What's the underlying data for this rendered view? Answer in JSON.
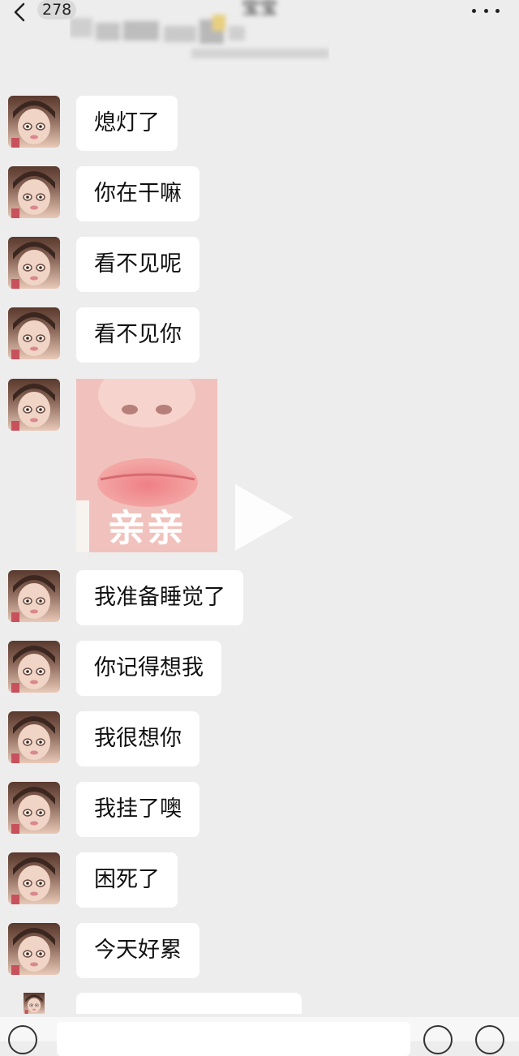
{
  "header": {
    "back_icon": "chevron-left-icon",
    "unread_count": "278",
    "title": "宝宝",
    "more_icon": "more-dots-icon"
  },
  "messages": [
    {
      "type": "text",
      "text": "熄灯了"
    },
    {
      "type": "text",
      "text": "你在干嘛"
    },
    {
      "type": "text",
      "text": "看不见呢"
    },
    {
      "type": "text",
      "text": "看不见你"
    },
    {
      "type": "sticker",
      "caption": "亲亲"
    },
    {
      "type": "text",
      "text": "我准备睡觉了"
    },
    {
      "type": "text",
      "text": "你记得想我"
    },
    {
      "type": "text",
      "text": "我很想你"
    },
    {
      "type": "text",
      "text": "我挂了噢"
    },
    {
      "type": "text",
      "text": "困死了"
    },
    {
      "type": "text",
      "text": "今天好累"
    }
  ],
  "input_bar": {
    "voice_icon": "voice-icon",
    "emoji_icon": "emoji-icon",
    "plus_icon": "plus-icon"
  },
  "colors": {
    "background": "#ededed",
    "bubble": "#ffffff",
    "text": "#111111"
  }
}
